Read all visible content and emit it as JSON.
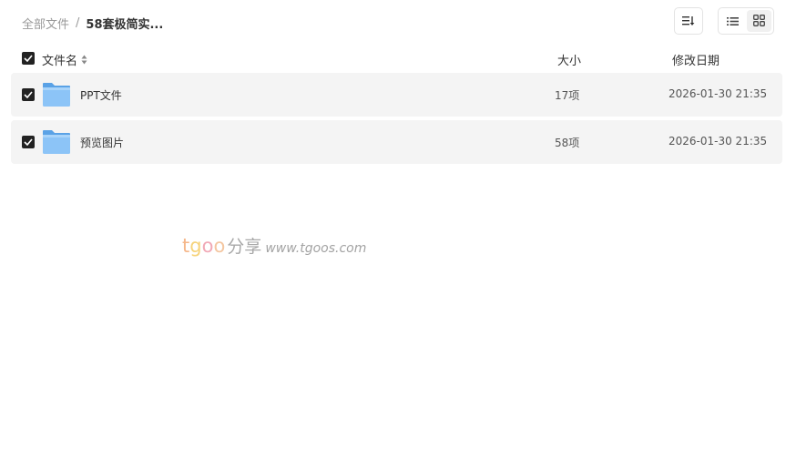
{
  "breadcrumb": {
    "root": "全部文件",
    "separator": "/",
    "current": "58套极简实..."
  },
  "toolbar": {
    "sort_icon": "sort-icon",
    "list_view_icon": "list-view-icon",
    "grid_view_icon": "grid-view-icon",
    "active_view": "grid"
  },
  "table": {
    "headers": {
      "name": "文件名",
      "size": "大小",
      "date": "修改日期"
    },
    "rows": [
      {
        "name": "PPT文件",
        "size": "17项",
        "date": "2026-01-30 21:35",
        "icon": "folder-icon",
        "checked": true
      },
      {
        "name": "预览图片",
        "size": "58项",
        "date": "2026-01-30 21:35",
        "icon": "folder-icon",
        "checked": true
      }
    ]
  },
  "watermark": {
    "t": "t",
    "g": "g",
    "o1": "o",
    "o2": "o",
    "cn": "分享",
    "url": "www.tgoos.com"
  },
  "colors": {
    "checkbox": "#222222",
    "row_bg": "#f4f4f4",
    "folder": "#6fb2f0"
  }
}
